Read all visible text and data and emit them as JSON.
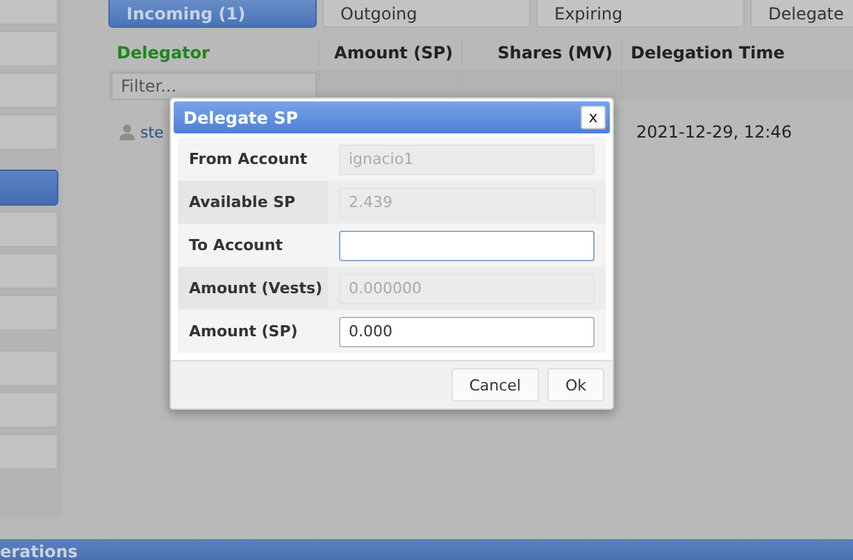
{
  "sidebar": {
    "groups": [
      [
        {
          "selected": false
        },
        {
          "selected": false
        },
        {
          "selected": false
        },
        {
          "selected": false
        }
      ],
      [
        {
          "selected": true
        },
        {
          "selected": false
        },
        {
          "selected": false
        },
        {
          "selected": false
        }
      ],
      [
        {
          "selected": false
        },
        {
          "selected": false
        },
        {
          "selected": false
        }
      ]
    ]
  },
  "tabs": [
    {
      "label": "Incoming (1)",
      "selected": true
    },
    {
      "label": "Outgoing",
      "selected": false
    },
    {
      "label": "Expiring",
      "selected": false
    },
    {
      "label": "Delegate",
      "selected": false
    }
  ],
  "table": {
    "columns": [
      {
        "label": "Delegator",
        "sorted": true
      },
      {
        "label": "Amount (SP)",
        "sorted": false
      },
      {
        "label": "Shares (MV)",
        "sorted": false
      },
      {
        "label": "Delegation Time",
        "sorted": false
      }
    ],
    "filter": {
      "placeholder": "Filter..."
    },
    "rows": [
      {
        "delegator": "ste",
        "time": "2021-12-29, 12:46"
      }
    ]
  },
  "dialog": {
    "title": "Delegate SP",
    "close": "x",
    "fields": [
      {
        "label": "From Account",
        "value": "ignacio1",
        "disabled": true,
        "focused": false
      },
      {
        "label": "Available SP",
        "value": "2.439",
        "disabled": true,
        "focused": false
      },
      {
        "label": "To Account",
        "disabled": false,
        "focused": true
      },
      {
        "label": "Amount (Vests)",
        "value": "0.000000",
        "disabled": true,
        "focused": false
      },
      {
        "label": "Amount (SP)",
        "value": "0.000",
        "disabled": false,
        "focused": false
      }
    ],
    "buttons": [
      "Cancel",
      "Ok"
    ]
  },
  "bottom_bar": {
    "title": "erations"
  }
}
